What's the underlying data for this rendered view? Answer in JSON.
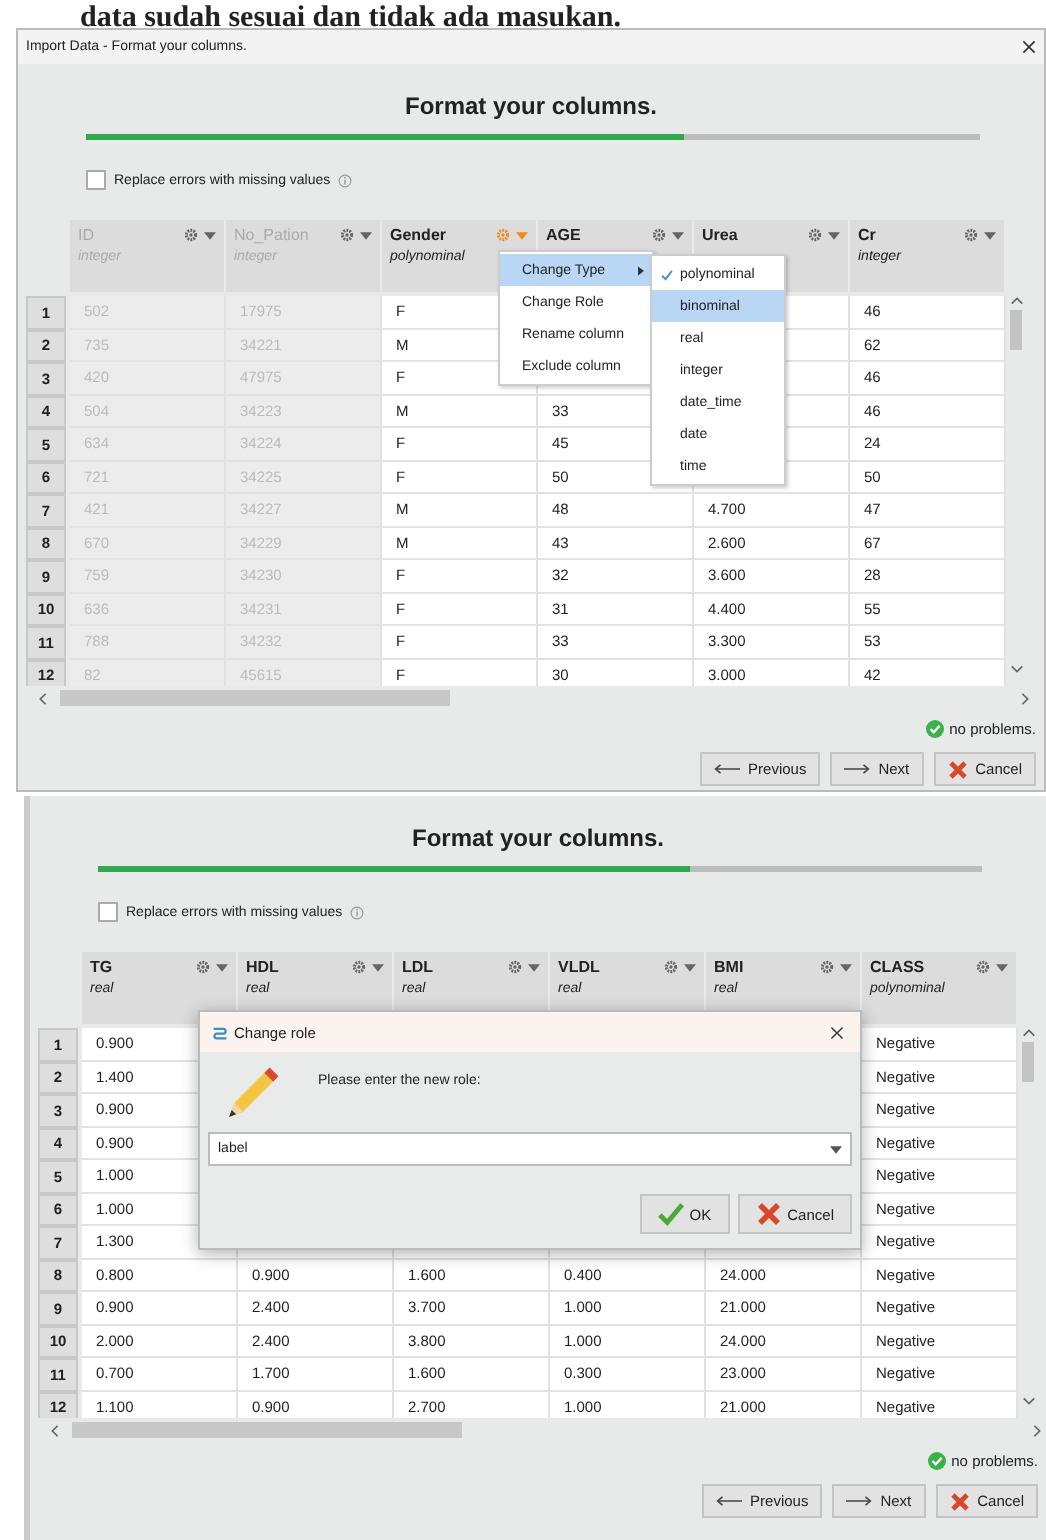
{
  "caption": "data sudah sesuai dan tidak ada masukan.",
  "screens": [
    {
      "window_title": "Import Data - Format your columns.",
      "heading": "Format your columns.",
      "progress": {
        "level": 0.67
      },
      "replace_errors": {
        "label": "Replace errors with missing values",
        "checked": false
      },
      "columns": [
        {
          "name": "ID",
          "type": "integer",
          "excluded": true,
          "menu_open": false
        },
        {
          "name": "No_Pation",
          "type": "integer",
          "excluded": true,
          "menu_open": false
        },
        {
          "name": "Gender",
          "type": "polynominal",
          "excluded": false,
          "menu_open": true
        },
        {
          "name": "AGE",
          "excluded": false,
          "menu_open": false
        },
        {
          "name": "Urea",
          "excluded": false,
          "menu_open": false
        },
        {
          "name": "Cr",
          "type": "integer",
          "excluded": false,
          "menu_open": false
        }
      ],
      "rows": [
        {
          "number": "1",
          "cells": [
            "502",
            "17975",
            "F",
            null,
            null,
            "46"
          ]
        },
        {
          "number": "2",
          "cells": [
            "735",
            "34221",
            "M",
            null,
            null,
            "62"
          ]
        },
        {
          "number": "3",
          "cells": [
            "420",
            "47975",
            "F",
            null,
            null,
            "46"
          ]
        },
        {
          "number": "4",
          "cells": [
            "504",
            "34223",
            "M",
            "33",
            null,
            "46"
          ]
        },
        {
          "number": "5",
          "cells": [
            "634",
            "34224",
            "F",
            "45",
            null,
            "24"
          ]
        },
        {
          "number": "6",
          "cells": [
            "721",
            "34225",
            "F",
            "50",
            null,
            "50"
          ]
        },
        {
          "number": "7",
          "cells": [
            "421",
            "34227",
            "M",
            "48",
            "4.700",
            "47"
          ]
        },
        {
          "number": "8",
          "cells": [
            "670",
            "34229",
            "M",
            "43",
            "2.600",
            "67"
          ]
        },
        {
          "number": "9",
          "cells": [
            "759",
            "34230",
            "F",
            "32",
            "3.600",
            "28"
          ]
        },
        {
          "number": "10",
          "cells": [
            "636",
            "34231",
            "F",
            "31",
            "4.400",
            "55"
          ]
        },
        {
          "number": "11",
          "cells": [
            "788",
            "34232",
            "F",
            "33",
            "3.300",
            "53"
          ]
        },
        {
          "number": "12",
          "cells": [
            "82",
            "45615",
            "F",
            "30",
            "3.000",
            "42"
          ]
        }
      ],
      "status": "no problems.",
      "buttons": [
        {
          "label": "Previous",
          "kind": "previous"
        },
        {
          "label": "Next",
          "kind": "next"
        },
        {
          "label": "Cancel",
          "kind": "cancel"
        }
      ],
      "overlay": {
        "kind": "column_menu",
        "items": [
          {
            "label": "Change Type",
            "submenu": true,
            "selected": true
          },
          {
            "label": "Change Role",
            "submenu": false,
            "selected": false
          },
          {
            "label": "Rename column",
            "submenu": false,
            "selected": false
          },
          {
            "label": "Exclude column",
            "submenu": false,
            "selected": false
          }
        ],
        "submenu": [
          {
            "label": "polynominal",
            "checked": true,
            "selected": false
          },
          {
            "label": "binominal",
            "checked": false,
            "selected": true
          },
          {
            "label": "real",
            "checked": false,
            "selected": false
          },
          {
            "label": "integer",
            "checked": false,
            "selected": false
          },
          {
            "label": "date_time",
            "checked": false,
            "selected": false
          },
          {
            "label": "date",
            "checked": false,
            "selected": false
          },
          {
            "label": "time",
            "checked": false,
            "selected": false
          }
        ]
      }
    },
    {
      "heading": "Format your columns.",
      "progress": {
        "level": 0.67
      },
      "replace_errors": {
        "label": "Replace errors with missing values",
        "checked": false
      },
      "columns": [
        {
          "name": "TG",
          "type": "real",
          "excluded": false,
          "menu_open": false
        },
        {
          "name": "HDL",
          "type": "real",
          "excluded": false,
          "menu_open": false
        },
        {
          "name": "LDL",
          "type": "real",
          "excluded": false,
          "menu_open": false
        },
        {
          "name": "VLDL",
          "type": "real",
          "excluded": false,
          "menu_open": false
        },
        {
          "name": "BMI",
          "type": "real",
          "excluded": false,
          "menu_open": false
        },
        {
          "name": "CLASS",
          "type": "polynominal",
          "excluded": false,
          "menu_open": false
        }
      ],
      "rows": [
        {
          "number": "1",
          "cells": [
            "0.900",
            null,
            null,
            null,
            null,
            "Negative"
          ]
        },
        {
          "number": "2",
          "cells": [
            "1.400",
            null,
            null,
            null,
            null,
            "Negative"
          ]
        },
        {
          "number": "3",
          "cells": [
            "0.900",
            null,
            null,
            null,
            null,
            "Negative"
          ]
        },
        {
          "number": "4",
          "cells": [
            "0.900",
            null,
            null,
            null,
            null,
            "Negative"
          ]
        },
        {
          "number": "5",
          "cells": [
            "1.000",
            null,
            null,
            null,
            null,
            "Negative"
          ]
        },
        {
          "number": "6",
          "cells": [
            "1.000",
            null,
            null,
            null,
            null,
            "Negative"
          ]
        },
        {
          "number": "7",
          "cells": [
            "1.300",
            null,
            null,
            null,
            null,
            "Negative"
          ]
        },
        {
          "number": "8",
          "cells": [
            "0.800",
            "0.900",
            "1.600",
            "0.400",
            "24.000",
            "Negative"
          ]
        },
        {
          "number": "9",
          "cells": [
            "0.900",
            "2.400",
            "3.700",
            "1.000",
            "21.000",
            "Negative"
          ]
        },
        {
          "number": "10",
          "cells": [
            "2.000",
            "2.400",
            "3.800",
            "1.000",
            "24.000",
            "Negative"
          ]
        },
        {
          "number": "11",
          "cells": [
            "0.700",
            "1.700",
            "1.600",
            "0.300",
            "23.000",
            "Negative"
          ]
        },
        {
          "number": "12",
          "cells": [
            "1.100",
            "0.900",
            "2.700",
            "1.000",
            "21.000",
            "Negative"
          ]
        }
      ],
      "status": "no problems.",
      "buttons": [
        {
          "label": "Previous",
          "kind": "previous"
        },
        {
          "label": "Next",
          "kind": "next"
        },
        {
          "label": "Cancel",
          "kind": "cancel"
        }
      ],
      "overlay": {
        "kind": "dialog",
        "title": "Change role",
        "message": "Please enter the new role:",
        "value": "label",
        "buttons": [
          {
            "label": "OK",
            "kind": "ok"
          },
          {
            "label": "Cancel",
            "kind": "cancel"
          }
        ]
      }
    }
  ]
}
